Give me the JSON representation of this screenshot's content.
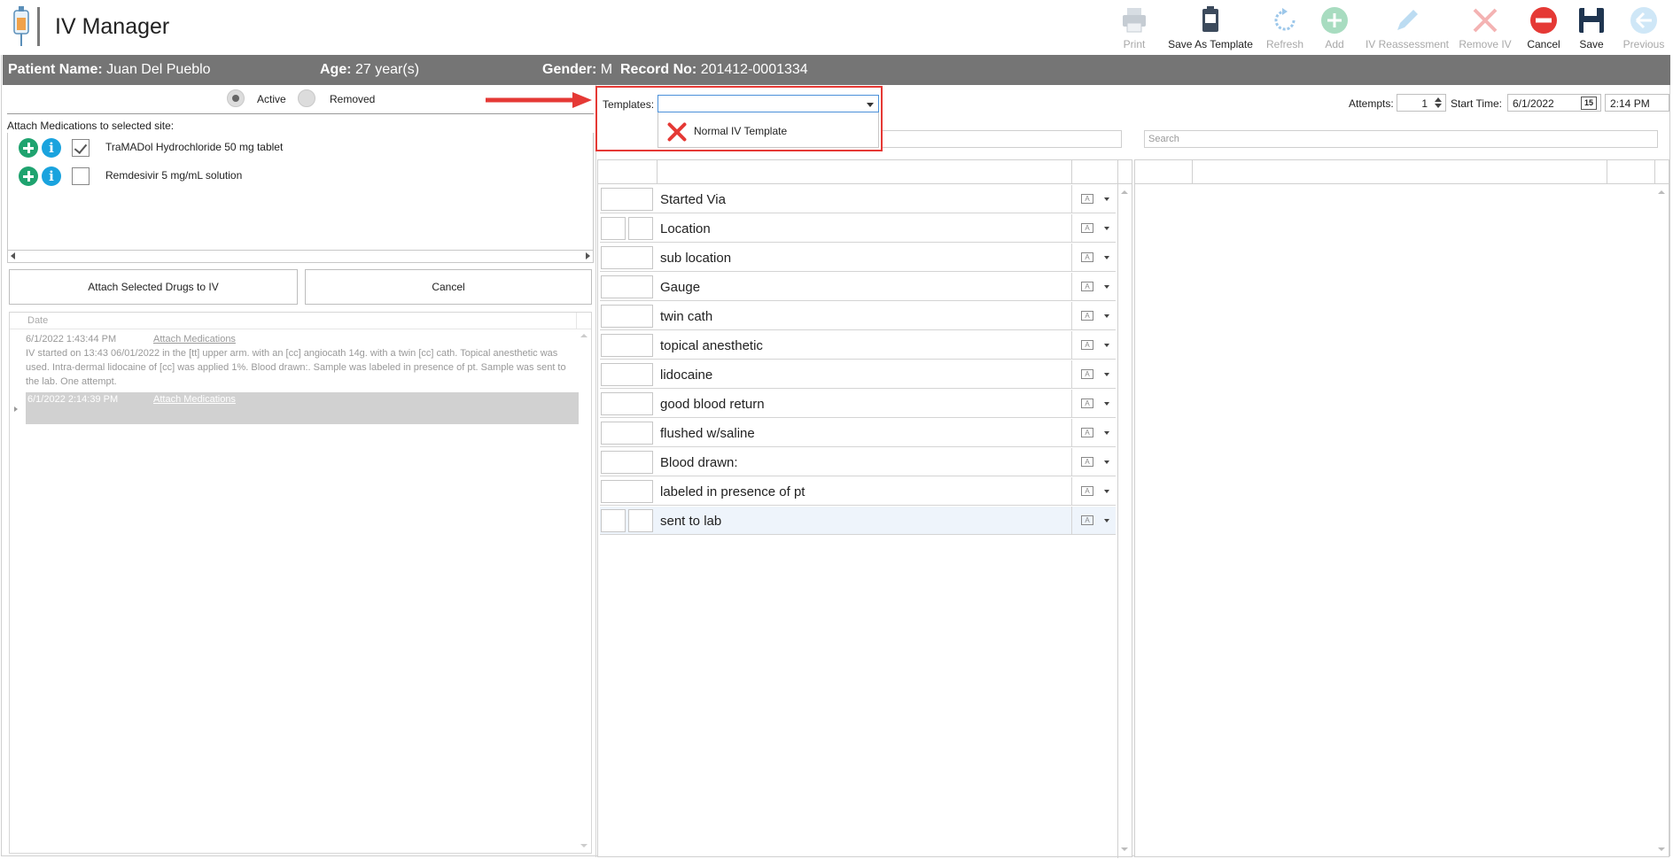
{
  "app": {
    "title": "IV Manager"
  },
  "toolbar": {
    "print": "Print",
    "save_as_template": "Save As Template",
    "refresh": "Refresh",
    "add": "Add",
    "iv_reassessment": "IV Reassessment",
    "remove_iv": "Remove IV",
    "cancel": "Cancel",
    "save": "Save",
    "previous": "Previous"
  },
  "patient": {
    "name_label": "Patient Name:",
    "name": "Juan Del Pueblo",
    "age_label": "Age:",
    "age": "27 year(s)",
    "gender_label": "Gender:",
    "gender": "M",
    "record_label": "Record No:",
    "record": "201412-0001334"
  },
  "site_filter": {
    "active": "Active",
    "removed": "Removed",
    "selected": "Active"
  },
  "attach": {
    "title": "Attach Medications to selected site:",
    "medications": [
      {
        "label": "TraMADol Hydrochloride 50 mg tablet",
        "checked": true
      },
      {
        "label": "Remdesivir 5 mg/mL solution",
        "checked": false
      }
    ],
    "attach_button": "Attach Selected Drugs to IV",
    "cancel_button": "Cancel"
  },
  "log": {
    "header": "Date",
    "entries": [
      {
        "date": "6/1/2022 1:43:44 PM",
        "link": "Attach Medications",
        "text": "IV started on 13:43 06/01/2022 in the [tt] upper arm. with an [cc] angiocath 14g. with a twin [cc] cath. Topical anesthetic was used. Intra-dermal lidocaine of [cc] was applied 1%. Blood drawn:. Sample was labeled in presence of pt. Sample was sent to the lab.  One attempt."
      },
      {
        "date": "6/1/2022 2:14:39 PM",
        "link": "Attach Medications",
        "text": ""
      }
    ]
  },
  "templates": {
    "label": "Templates:",
    "value": "",
    "options": [
      "Normal IV Template"
    ]
  },
  "search": {
    "left_placeholder": "Search",
    "right_placeholder": "Search"
  },
  "grid_rows": [
    {
      "label": "Started Via",
      "split": false
    },
    {
      "label": "Location",
      "split": true
    },
    {
      "label": "sub location",
      "split": false
    },
    {
      "label": "Gauge",
      "split": false
    },
    {
      "label": "twin cath",
      "split": false
    },
    {
      "label": "topical anesthetic",
      "split": false
    },
    {
      "label": "lidocaine",
      "split": false
    },
    {
      "label": "good blood return",
      "split": false
    },
    {
      "label": "flushed w/saline",
      "split": false
    },
    {
      "label": "Blood drawn:",
      "split": false
    },
    {
      "label": "labeled in presence of pt",
      "split": false
    },
    {
      "label": "sent to lab",
      "split": true
    }
  ],
  "attempts": {
    "label": "Attempts:",
    "value": "1"
  },
  "start_time": {
    "label": "Start Time:",
    "date": "6/1/2022",
    "time": "2:14 PM",
    "calendar_day": "15"
  },
  "colors": {
    "patient_bar": "#757575",
    "highlight": "#e53935",
    "add_green": "#1fa36f",
    "info_blue": "#1aa3de"
  }
}
